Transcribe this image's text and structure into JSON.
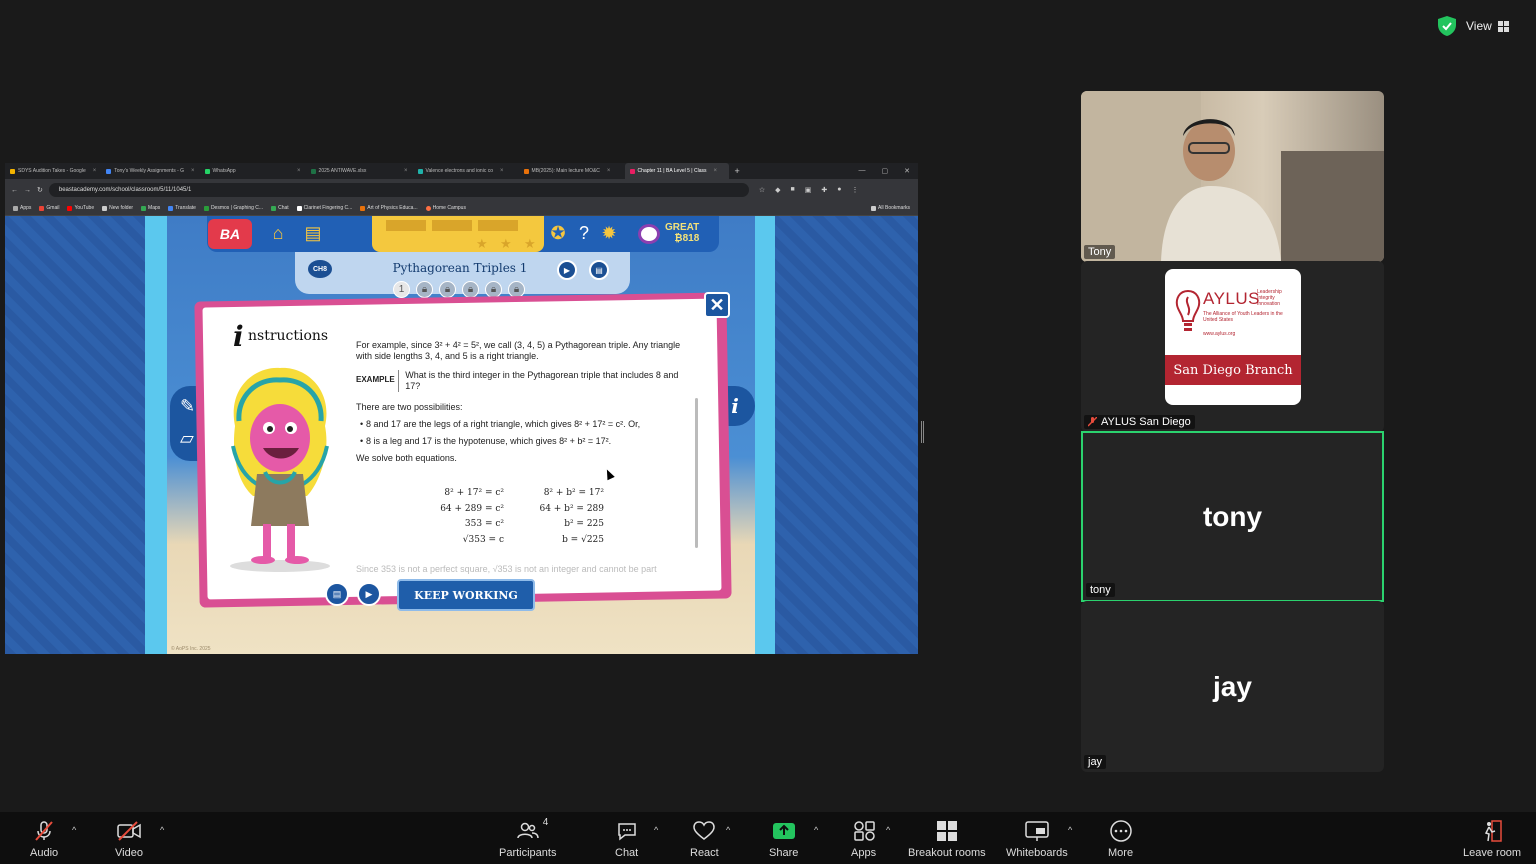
{
  "top_right": {
    "view_label": "View"
  },
  "browser": {
    "tabs": [
      {
        "label": "SDYS Audition Takes - Google",
        "color": "#f4b400"
      },
      {
        "label": "Tony's Weekly Assignments - G",
        "color": "#4285f4"
      },
      {
        "label": "WhatsApp",
        "color": "#25d366"
      },
      {
        "label": "2025 ANTIWAVE.xlsx",
        "color": "#1e7145"
      },
      {
        "label": "Valence electrons and ionic co",
        "color": "#20b2aa"
      },
      {
        "label": "MB(2025): Main lecture MO&C",
        "color": "#e8710a"
      },
      {
        "label": "Chapter 11 | BA Level 5 | Class",
        "color": "#e91e63"
      }
    ],
    "url": "beastacademy.com/school/classroom/5/11/1045/1",
    "bookmarks": [
      "Apps",
      "Gmail",
      "YouTube",
      "New folder",
      "Maps",
      "Translate",
      "Desmos | Graphing C...",
      "Chat",
      "Clarinet Fingering C...",
      "Art of Physics Educa...",
      "Home Campus"
    ],
    "all_bookmarks": "All Bookmarks"
  },
  "game": {
    "great_label": "GREAT",
    "points": "818",
    "chapter_badge": "CH8",
    "lesson_title": "Pythagorean Triples 1",
    "current_page": "1",
    "instructions_title": "nstructions",
    "paragraph_1": "For example, since 3² + 4² = 5², we call (3, 4, 5) a Pythagorean triple. Any triangle with side lengths 3, 4, and 5 is a right triangle.",
    "example_label": "EXAMPLE",
    "example_text": "What is the third integer in the Pythagorean triple that includes 8 and 17?",
    "paragraph_2": "There are two possibilities:",
    "bullet_1": "8 and 17 are the legs of a right triangle, which gives 8² + 17² = c². Or,",
    "bullet_2": "8 is a leg and 17 is the hypotenuse, which gives 8² + b² = 17².",
    "paragraph_3": "We solve both equations.",
    "eq_left": [
      "8² + 17² = c²",
      "64 + 289 = c²",
      "353 = c²",
      "√353 = c"
    ],
    "eq_right": [
      "8² + b² = 17²",
      "64 + b² = 289",
      "b² = 225",
      "b = √225"
    ],
    "faded_text": "Since 353 is not a perfect square, √353 is not an integer and cannot be part",
    "keep_working": "KEEP WORKING",
    "copyright": "© AoPS Inc. 2025"
  },
  "participants": [
    {
      "name": "Tony",
      "type": "video"
    },
    {
      "name": "AYLUS San Diego",
      "type": "logo",
      "muted": true
    },
    {
      "name": "tony",
      "type": "name",
      "big": "tony",
      "active": true
    },
    {
      "name": "jay",
      "type": "name",
      "big": "jay"
    }
  ],
  "aylus": {
    "title": "AYLUS",
    "tagline": "Leadership Integrity Innovation",
    "subtitle": "The Alliance of Youth Leaders in the United States",
    "url": "www.aylus.org",
    "branch": "San Diego Branch"
  },
  "toolbar": {
    "audio": "Audio",
    "video": "Video",
    "participants": "Participants",
    "participants_count": "4",
    "chat": "Chat",
    "react": "React",
    "share": "Share",
    "apps": "Apps",
    "breakout": "Breakout rooms",
    "whiteboards": "Whiteboards",
    "more": "More",
    "leave": "Leave room"
  }
}
